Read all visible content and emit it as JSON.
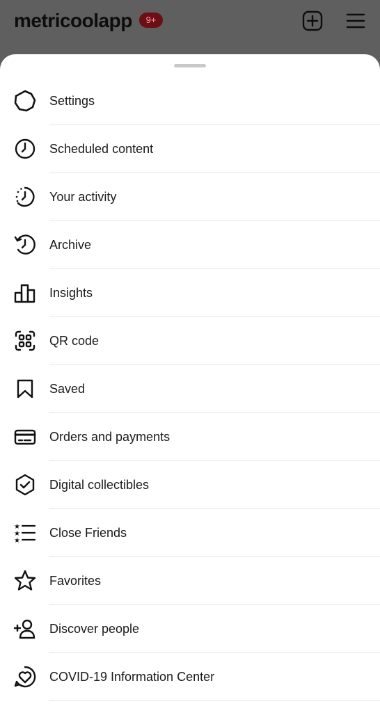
{
  "header": {
    "username": "metricoolapp",
    "notification_badge": "9+",
    "add_icon": "add-square-icon",
    "menu_icon": "hamburger-menu-icon"
  },
  "menu": {
    "items": [
      {
        "label": "Settings",
        "icon": "gear-icon"
      },
      {
        "label": "Scheduled content",
        "icon": "clock-icon"
      },
      {
        "label": "Your activity",
        "icon": "activity-clock-icon"
      },
      {
        "label": "Archive",
        "icon": "archive-history-icon"
      },
      {
        "label": "Insights",
        "icon": "bar-chart-icon"
      },
      {
        "label": "QR code",
        "icon": "qr-code-icon"
      },
      {
        "label": "Saved",
        "icon": "bookmark-icon"
      },
      {
        "label": "Orders and payments",
        "icon": "card-icon"
      },
      {
        "label": "Digital collectibles",
        "icon": "verified-shield-icon"
      },
      {
        "label": "Close Friends",
        "icon": "star-list-icon"
      },
      {
        "label": "Favorites",
        "icon": "star-icon"
      },
      {
        "label": "Discover people",
        "icon": "add-person-icon"
      },
      {
        "label": "COVID-19 Information Center",
        "icon": "heart-badge-icon"
      }
    ]
  },
  "colors": {
    "overlay": "#5f5f5f",
    "sheet": "#ffffff",
    "badge_bg": "#6b0f14",
    "divider": "#e6e6e6"
  }
}
